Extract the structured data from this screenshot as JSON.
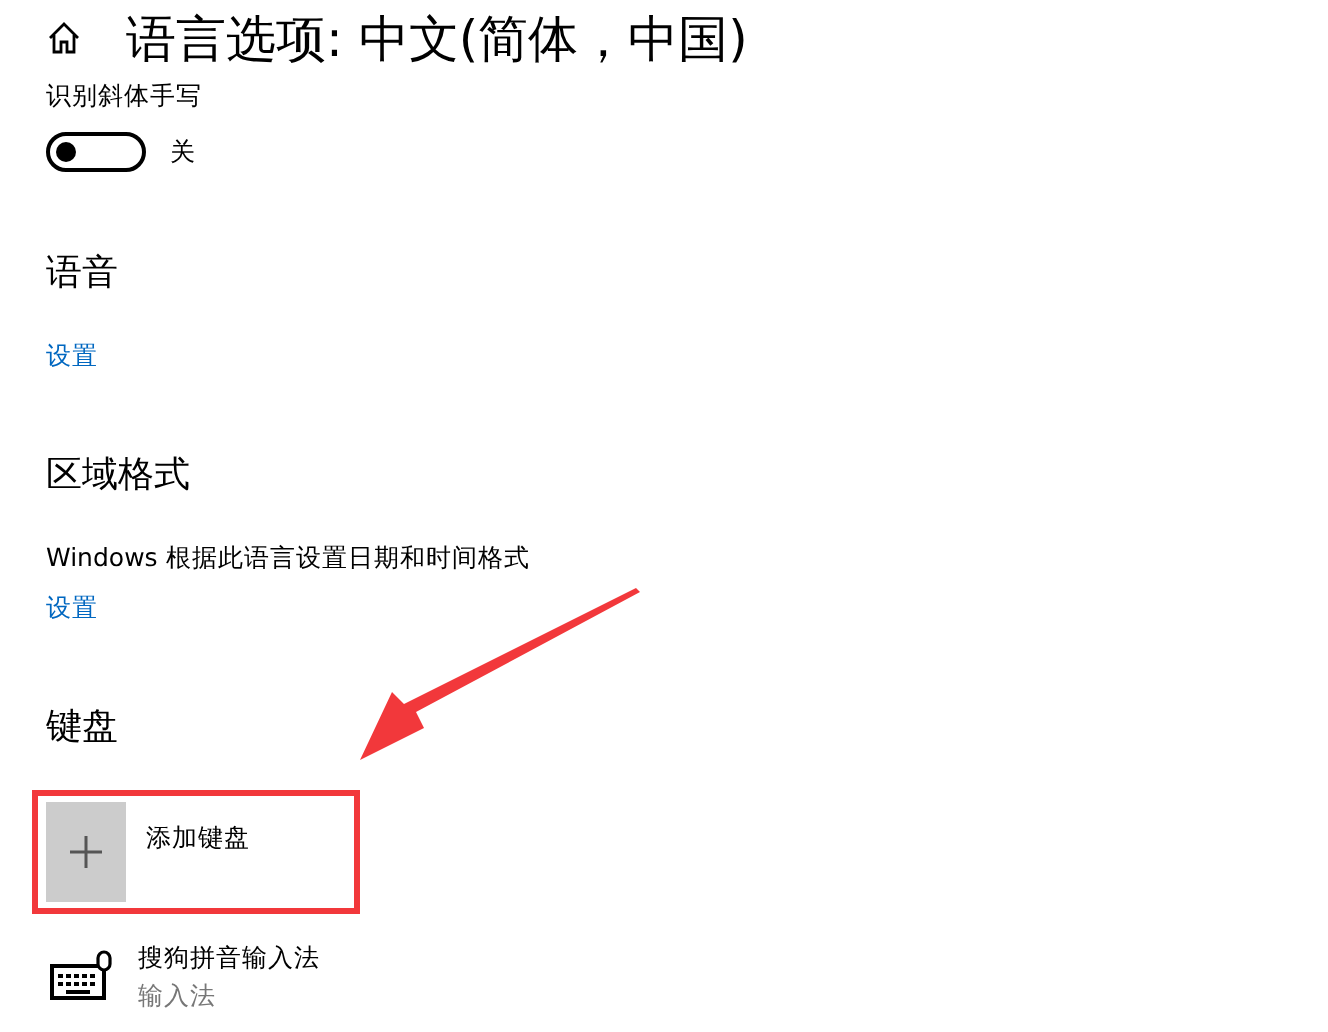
{
  "page_title": "语言选项: 中文(简体，中国)",
  "handwriting": {
    "label": "识别斜体手写",
    "on": false,
    "state_text": "关"
  },
  "sections": [
    {
      "heading": "语音",
      "link": "设置"
    },
    {
      "heading": "区域格式",
      "description": "Windows 根据此语言设置日期和时间格式",
      "link": "设置"
    }
  ],
  "keyboard": {
    "heading": "键盘",
    "add_label": "添加键盘",
    "items": [
      {
        "name": "搜狗拼音输入法",
        "subtitle": "输入法"
      }
    ]
  }
}
